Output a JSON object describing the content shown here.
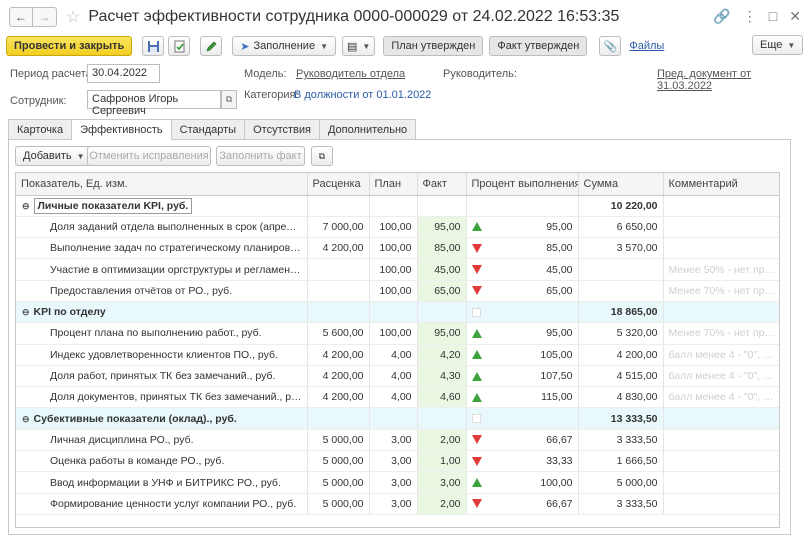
{
  "window": {
    "title": "Расчет эффективности сотрудника 0000-000029 от 24.02.2022 16:53:35"
  },
  "toolbar": {
    "post_and_close": "Провести и закрыть",
    "fill": "Заполнение",
    "plan_approved": "План утвержден",
    "fact_approved": "Факт утвержден",
    "files": "Файлы",
    "more": "Еще"
  },
  "form": {
    "period_label": "Период расчета:",
    "period_value": "30.04.2022",
    "employee_label": "Сотрудник:",
    "employee_value": "Сафронов Игорь Сергеевич",
    "model_label": "Модель:",
    "model_value": "Руководитель отдела",
    "category_label": "Категория:",
    "category_value": "В должности от 01.01.2022",
    "manager_label": "Руководитель:",
    "prev_doc": "Пред. документ от 31.03.2022"
  },
  "tabs": [
    "Карточка",
    "Эффективность",
    "Стандарты",
    "Отсутствия",
    "Дополнительно"
  ],
  "subtoolbar": {
    "add": "Добавить",
    "cancel_fixes": "Отменить исправления",
    "fill_fact": "Заполнить факт"
  },
  "table": {
    "headers": [
      "Показатель, Ед. изм.",
      "Расценка",
      "План",
      "Факт",
      "Процент выполнения",
      "Сумма",
      "Комментарий"
    ],
    "rows": [
      {
        "type": "group",
        "name": "Личные показатели KPI, руб.",
        "sum": "10 220,00"
      },
      {
        "type": "row",
        "name": "Доля заданий отдела выполненных в срок (апрель-но...",
        "rate": "7 000,00",
        "plan": "100,00",
        "fact": "95,00",
        "trend": "up",
        "pct": "95,00",
        "sum": "6 650,00",
        "comment": ""
      },
      {
        "type": "row",
        "name": "Выполнение задач по стратегическому планированию...",
        "rate": "4 200,00",
        "plan": "100,00",
        "fact": "85,00",
        "trend": "down",
        "pct": "85,00",
        "sum": "3 570,00",
        "comment": ""
      },
      {
        "type": "row",
        "name": "Участие в оптимизации оргструктуры и регламентах п...",
        "rate": "",
        "plan": "100,00",
        "fact": "45,00",
        "trend": "down",
        "pct": "45,00",
        "sum": "",
        "comment": "Менее 50% - нет премии"
      },
      {
        "type": "row",
        "name": "Предоставления отчётов от РО., руб.",
        "rate": "",
        "plan": "100,00",
        "fact": "65,00",
        "trend": "down",
        "pct": "65,00",
        "sum": "",
        "comment": "Менее 70% - нет премии"
      },
      {
        "type": "group2",
        "name": "KPI по отделу",
        "sum": "18 865,00"
      },
      {
        "type": "row",
        "name": "Процент плана по выполнению работ., руб.",
        "rate": "5 600,00",
        "plan": "100,00",
        "fact": "95,00",
        "trend": "up",
        "pct": "95,00",
        "sum": "5 320,00",
        "comment": "Менее 70% - нет премии"
      },
      {
        "type": "row",
        "name": "Индекс удовлетворенности клиентов ПО., руб.",
        "rate": "4 200,00",
        "plan": "4,00",
        "fact": "4,20",
        "trend": "up",
        "pct": "105,00",
        "sum": "4 200,00",
        "comment": "балл менее 4 - \"0\", ба..."
      },
      {
        "type": "row",
        "name": "Доля работ, принятых ТК без замечаний., руб.",
        "rate": "4 200,00",
        "plan": "4,00",
        "fact": "4,30",
        "trend": "up",
        "pct": "107,50",
        "sum": "4 515,00",
        "comment": "балл менее 4 - \"0\", ба..."
      },
      {
        "type": "row",
        "name": "Доля документов, принятых ТК без замечаний., руб.",
        "rate": "4 200,00",
        "plan": "4,00",
        "fact": "4,60",
        "trend": "up",
        "pct": "115,00",
        "sum": "4 830,00",
        "comment": "балл менее 4 - \"0\", ба..."
      },
      {
        "type": "group2",
        "name": "Субективные показатели (оклад)., руб.",
        "sum": "13 333,50"
      },
      {
        "type": "row",
        "name": "Личная дисциплина РО., руб.",
        "rate": "5 000,00",
        "plan": "3,00",
        "fact": "2,00",
        "trend": "down",
        "pct": "66,67",
        "sum": "3 333,50",
        "comment": ""
      },
      {
        "type": "row",
        "name": "Оценка работы в команде РО., руб.",
        "rate": "5 000,00",
        "plan": "3,00",
        "fact": "1,00",
        "trend": "down",
        "pct": "33,33",
        "sum": "1 666,50",
        "comment": ""
      },
      {
        "type": "row",
        "name": "Ввод информации в УНФ и БИТРИКС РО., руб.",
        "rate": "5 000,00",
        "plan": "3,00",
        "fact": "3,00",
        "trend": "up",
        "pct": "100,00",
        "sum": "5 000,00",
        "comment": ""
      },
      {
        "type": "row",
        "name": "Формирование ценности услуг компании РО., руб.",
        "rate": "5 000,00",
        "plan": "3,00",
        "fact": "2,00",
        "trend": "down",
        "pct": "66,67",
        "sum": "3 333,50",
        "comment": ""
      }
    ]
  }
}
